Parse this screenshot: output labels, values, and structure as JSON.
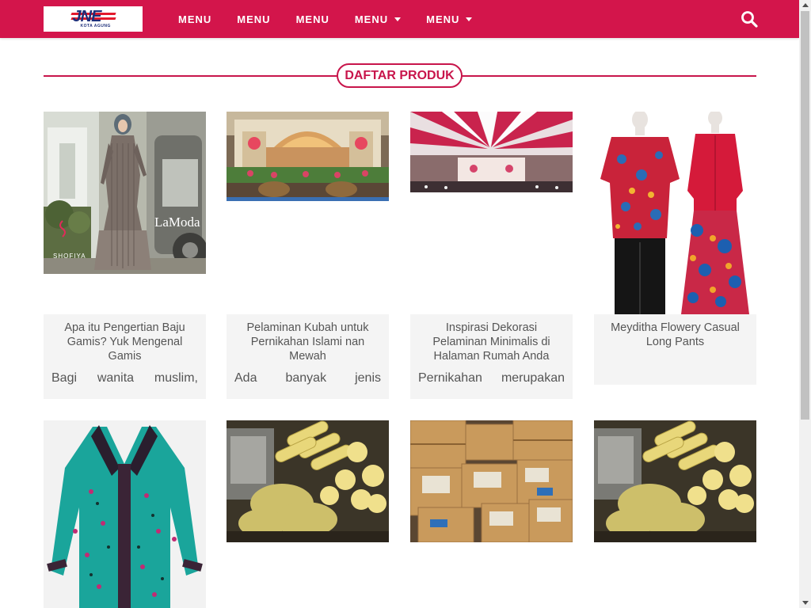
{
  "header": {
    "logo_text": "JNE",
    "logo_sub": "KOTA AGUNG",
    "brand_color": "#d3154b",
    "nav": [
      {
        "label": "MENU",
        "dropdown": false
      },
      {
        "label": "MENU",
        "dropdown": false
      },
      {
        "label": "MENU",
        "dropdown": false
      },
      {
        "label": "MENU",
        "dropdown": true
      },
      {
        "label": "MENU",
        "dropdown": true
      }
    ],
    "search_icon": "search-icon"
  },
  "section": {
    "title": "DAFTAR PRODUK"
  },
  "products": [
    {
      "title": "Apa itu Pengertian Baju Gamis? Yuk Mengenal Gamis",
      "excerpt": "Bagi wanita muslim,"
    },
    {
      "title": "Pelaminan Kubah untuk Pernikahan Islami nan Mewah",
      "excerpt": "Ada banyak jenis"
    },
    {
      "title": "Inspirasi Dekorasi Pelaminan Minimalis di Halaman Rumah Anda",
      "excerpt": "Pernikahan merupakan"
    },
    {
      "title": "Meyditha Flowery Casual Long Pants",
      "excerpt": ""
    }
  ],
  "images": {
    "gamis_watermark": "LaModa",
    "gamis_brand": "SHOFIYA"
  }
}
